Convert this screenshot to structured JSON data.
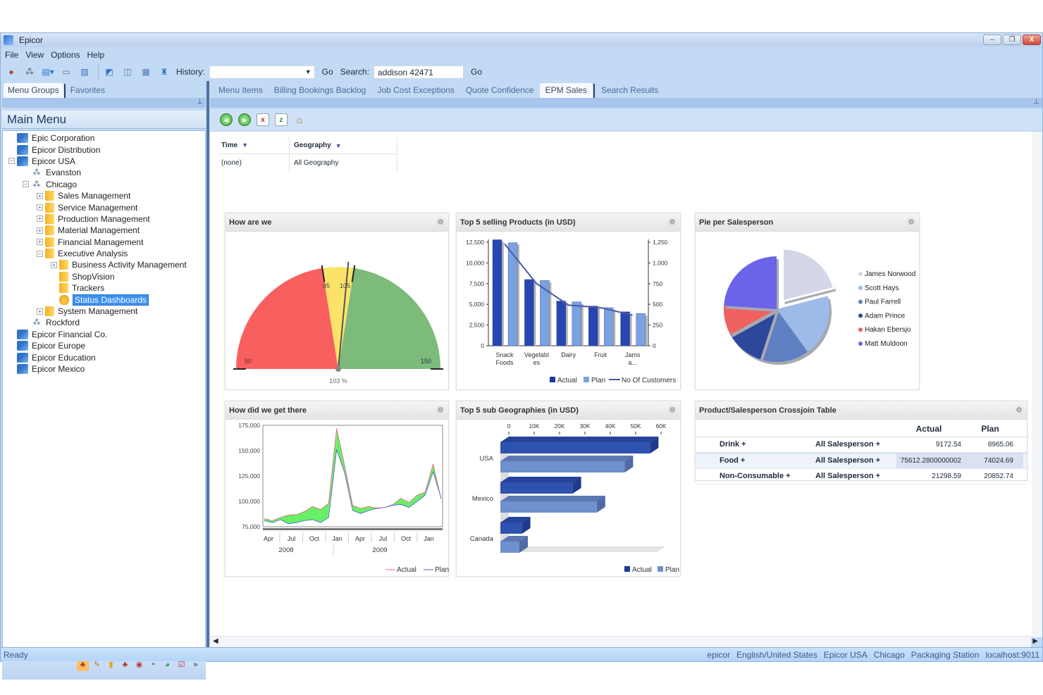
{
  "window": {
    "title": "Epicor",
    "controls": {
      "minimize": "–",
      "restore": "❐",
      "close": "X"
    }
  },
  "menubar": [
    "File",
    "View",
    "Options",
    "Help"
  ],
  "toolbar": {
    "icons": [
      "users-icon",
      "org-chart-icon",
      "company-icon",
      "card-icon",
      "doc-icon",
      "people-icon",
      "search-doc-icon",
      "calendar-icon",
      "graduate-icon"
    ],
    "history_label": "History:",
    "history_value": "",
    "go_label": "Go",
    "search_label": "Search:",
    "search_value": "addison 42471",
    "search_go_label": "Go"
  },
  "left_tabs": [
    {
      "label": "Menu Groups",
      "active": true
    },
    {
      "label": "Favorites",
      "active": false
    }
  ],
  "main_menu": {
    "title": "Main Menu",
    "tree": [
      {
        "label": "Epic Corporation",
        "level": 0,
        "icon": "company",
        "exp": ""
      },
      {
        "label": "Epicor Distribution",
        "level": 0,
        "icon": "company",
        "exp": ""
      },
      {
        "label": "Epicor USA",
        "level": 0,
        "icon": "company",
        "exp": "−"
      },
      {
        "label": "Evanston",
        "level": 1,
        "icon": "site",
        "exp": ""
      },
      {
        "label": "Chicago",
        "level": 1,
        "icon": "site",
        "exp": "−"
      },
      {
        "label": "Sales Management",
        "level": 2,
        "icon": "folder",
        "exp": "+"
      },
      {
        "label": "Service Management",
        "level": 2,
        "icon": "folder",
        "exp": "+"
      },
      {
        "label": "Production Management",
        "level": 2,
        "icon": "folder",
        "exp": "+"
      },
      {
        "label": "Material Management",
        "level": 2,
        "icon": "folder",
        "exp": "+"
      },
      {
        "label": "Financial Management",
        "level": 2,
        "icon": "folder",
        "exp": "+"
      },
      {
        "label": "Executive Analysis",
        "level": 2,
        "icon": "folder",
        "exp": "−"
      },
      {
        "label": "Business Activity Management",
        "level": 3,
        "icon": "folder",
        "exp": "+"
      },
      {
        "label": "ShopVision",
        "level": 3,
        "icon": "folder",
        "exp": ""
      },
      {
        "label": "Trackers",
        "level": 3,
        "icon": "folder",
        "exp": ""
      },
      {
        "label": "Status Dashboards",
        "level": 3,
        "icon": "dash",
        "exp": "",
        "selected": true
      },
      {
        "label": "System Management",
        "level": 2,
        "icon": "folder",
        "exp": "+"
      },
      {
        "label": "Rockford",
        "level": 1,
        "icon": "site",
        "exp": ""
      },
      {
        "label": "Epicor Financial Co.",
        "level": 0,
        "icon": "company",
        "exp": ""
      },
      {
        "label": "Epicor Europe",
        "level": 0,
        "icon": "company",
        "exp": ""
      },
      {
        "label": "Epicor Education",
        "level": 0,
        "icon": "company",
        "exp": ""
      },
      {
        "label": "Epicor Mexico",
        "level": 0,
        "icon": "company",
        "exp": ""
      }
    ]
  },
  "right_tabs": [
    {
      "label": "Menu Items",
      "active": false
    },
    {
      "label": "Billing Bookings Backlog",
      "active": false
    },
    {
      "label": "Job Cost Exceptions",
      "active": false
    },
    {
      "label": "Quote Confidence",
      "active": false
    },
    {
      "label": "EPM Sales",
      "active": true
    },
    {
      "label": "Search Results",
      "active": false
    }
  ],
  "filters": {
    "headers": [
      "Time",
      "Geography"
    ],
    "values": [
      "(none)",
      "All Geography"
    ]
  },
  "widgets": {
    "gauge": {
      "title": "How are we"
    },
    "products": {
      "title": "Top 5 selling Products (in USD)"
    },
    "pie": {
      "title": "Pie per Salesperson"
    },
    "trend": {
      "title": "How did we get there"
    },
    "geo": {
      "title": "Top 5 sub Geographies (in USD)"
    },
    "crossjoin": {
      "title": "Product/Salesperson Crossjoin Table",
      "columns": [
        "",
        "",
        "Actual",
        "Plan"
      ],
      "rows": [
        {
          "product": "Drink +",
          "salesperson": "All Salesperson +",
          "actual": "9172.54",
          "plan": "8965.06"
        },
        {
          "product": "Food +",
          "salesperson": "All Salesperson +",
          "actual": "75612.2800000002",
          "plan": "74024.69"
        },
        {
          "product": "Non-Consumable +",
          "salesperson": "All Salesperson +",
          "actual": "21298.59",
          "plan": "20852.74"
        }
      ]
    }
  },
  "statusbar": {
    "left": "Ready",
    "right": [
      "epicor",
      "English/United States",
      "Epicor USA",
      "Chicago",
      "Packaging Station",
      "localhost:9011"
    ]
  },
  "chart_data": [
    {
      "type": "gauge",
      "title": "How are we",
      "min": 50,
      "max": 150,
      "value": 103,
      "value_label": "103 %",
      "bands": [
        {
          "from": 50,
          "to": 95,
          "color": "#f86060"
        },
        {
          "from": 95,
          "to": 105,
          "color": "#fbe36a"
        },
        {
          "from": 105,
          "to": 150,
          "color": "#7cbb7a"
        }
      ],
      "tick_labels": [
        "50",
        "95",
        "105",
        "150"
      ]
    },
    {
      "type": "bar",
      "title": "Top 5 selling Products (in USD)",
      "categories": [
        "Snack Foods",
        "Vegetables",
        "Dairy",
        "Fruit",
        "Jams a..."
      ],
      "category_labels": [
        [
          "Snack",
          "Foods"
        ],
        [
          "Vegetabl",
          "es"
        ],
        [
          "Dairy"
        ],
        [
          "Fruit"
        ],
        [
          "Jams",
          "a..."
        ]
      ],
      "series": [
        {
          "name": "Actual",
          "values": [
            12800,
            8000,
            5400,
            4800,
            4100
          ],
          "color": "#2846b0",
          "axis": "left"
        },
        {
          "name": "Plan",
          "values": [
            12450,
            7900,
            5300,
            4600,
            3900
          ],
          "color": "#7ba2de",
          "axis": "left"
        },
        {
          "name": "No Of Customers",
          "type": "line",
          "values": [
            1230,
            750,
            490,
            460,
            370
          ],
          "color": "#4a5aa8",
          "axis": "right"
        }
      ],
      "ylim": [
        0,
        12500
      ],
      "yticks": [
        "0",
        "2,500",
        "5,000",
        "7,500",
        "10,000",
        "12,500"
      ],
      "y2lim": [
        0,
        1250
      ],
      "y2ticks": [
        "0",
        "250",
        "500",
        "750",
        "1,000",
        "1,250"
      ],
      "legend": "bottom-right"
    },
    {
      "type": "pie",
      "title": "Pie per Salesperson",
      "slices": [
        {
          "label": "James Norwood",
          "value": 21,
          "color": "#d2d6e6",
          "exploded": true
        },
        {
          "label": "Scott Hays",
          "value": 19,
          "color": "#9dbbe8"
        },
        {
          "label": "Paul Farrell",
          "value": 15,
          "color": "#5e80c2"
        },
        {
          "label": "Adam Prince",
          "value": 12,
          "color": "#2c479c"
        },
        {
          "label": "Hakan Ebersjo",
          "value": 9,
          "color": "#ef6060"
        },
        {
          "label": "Matt Muldoon",
          "value": 24,
          "color": "#6b63e8"
        }
      ],
      "legend": "right"
    },
    {
      "type": "area",
      "title": "How did we get there",
      "x": [
        "Apr 2008",
        "May 2008",
        "Jun 2008",
        "Jul 2008",
        "Aug 2008",
        "Sep 2008",
        "Oct 2008",
        "Nov 2008",
        "Dec 2008",
        "Jan 2009",
        "Feb 2009",
        "Mar 2009",
        "Apr 2009",
        "May 2009",
        "Jun 2009",
        "Jul 2009",
        "Aug 2009",
        "Sep 2009",
        "Oct 2009",
        "Nov 2009",
        "Dec 2009",
        "Jan 2010",
        "Feb 2010"
      ],
      "xticks": [
        "Apr",
        "Jul",
        "Oct",
        "Jan",
        "Apr",
        "Jul",
        "Oct",
        "Jan"
      ],
      "xgroups": [
        "2008",
        "2009"
      ],
      "series": [
        {
          "name": "Actual",
          "values": [
            83000,
            81000,
            84000,
            86500,
            87000,
            90000,
            95000,
            92000,
            98000,
            172000,
            135000,
            96000,
            93000,
            95000,
            93500,
            94000,
            97000,
            103000,
            99000,
            106000,
            109000,
            137000,
            102000
          ],
          "color": "#ff5a7a"
        },
        {
          "name": "Plan",
          "values": [
            81000,
            79000,
            82000,
            78000,
            79000,
            81000,
            82000,
            79000,
            84000,
            151000,
            128000,
            91000,
            88000,
            91000,
            93000,
            94000,
            96000,
            97000,
            94000,
            100000,
            106000,
            129000,
            103000
          ],
          "color": "#4a5ad8"
        }
      ],
      "fill_above": "#66f066",
      "fill_below": "#f06070",
      "ylim": [
        75000,
        175000
      ],
      "yticks": [
        "75,000",
        "100,000",
        "125,000",
        "150,000",
        "175,000"
      ],
      "legend": "bottom-right"
    },
    {
      "type": "bar",
      "orientation": "horizontal",
      "title": "Top 5 sub Geographies (in USD)",
      "categories": [
        "USA",
        "Mexico",
        "Canada"
      ],
      "series": [
        {
          "name": "Actual",
          "values": [
            59000,
            28500,
            8500
          ],
          "color": "#2f51b0"
        },
        {
          "name": "Plan",
          "values": [
            49000,
            38000,
            7500
          ],
          "color": "#6e90cc"
        }
      ],
      "xlim": [
        0,
        60000
      ],
      "xticks": [
        "0",
        "10K",
        "20K",
        "30K",
        "40K",
        "50K",
        "60K"
      ],
      "legend": "bottom-right"
    }
  ]
}
